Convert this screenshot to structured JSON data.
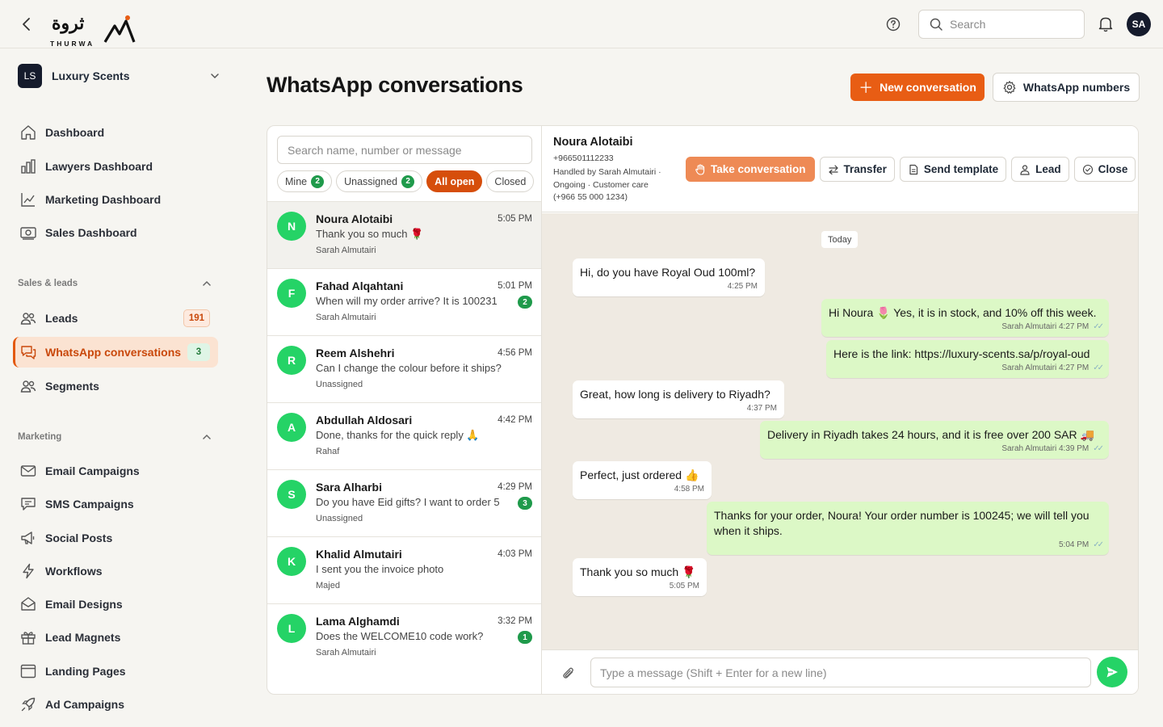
{
  "brand": {
    "arabic": "ثروة",
    "latin": "THURWA"
  },
  "topbar": {
    "search_placeholder": "Search",
    "avatar": "SA"
  },
  "workspace": {
    "initials": "LS",
    "name": "Luxury Scents"
  },
  "nav_primary": [
    {
      "label": "Dashboard",
      "icon": "home-icon"
    },
    {
      "label": "Lawyers Dashboard",
      "icon": "bar-chart-icon"
    },
    {
      "label": "Marketing Dashboard",
      "icon": "line-chart-icon"
    },
    {
      "label": "Sales Dashboard",
      "icon": "money-icon"
    }
  ],
  "sections": {
    "sales": {
      "title": "Sales & leads",
      "items": [
        {
          "label": "Leads",
          "icon": "users-icon",
          "count": "191"
        },
        {
          "label": "WhatsApp conversations",
          "icon": "chat-icon",
          "count": "3"
        },
        {
          "label": "Segments",
          "icon": "users-icon"
        }
      ]
    },
    "marketing": {
      "title": "Marketing",
      "items": [
        {
          "label": "Email Campaigns",
          "icon": "mail-icon"
        },
        {
          "label": "SMS Campaigns",
          "icon": "message-icon"
        },
        {
          "label": "Social Posts",
          "icon": "megaphone-icon"
        },
        {
          "label": "Workflows",
          "icon": "lightning-icon"
        },
        {
          "label": "Email Designs",
          "icon": "envelope-open-icon"
        },
        {
          "label": "Lead Magnets",
          "icon": "gift-icon"
        },
        {
          "label": "Landing Pages",
          "icon": "browser-icon"
        },
        {
          "label": "Ad Campaigns",
          "icon": "rocket-icon"
        }
      ]
    }
  },
  "page": {
    "title": "WhatsApp conversations",
    "new_button": "New conversation",
    "numbers_button": "WhatsApp numbers"
  },
  "conv_list": {
    "search_placeholder": "Search name, number or message",
    "filters": [
      {
        "label": "Mine",
        "count": "2"
      },
      {
        "label": "Unassigned",
        "count": "2"
      },
      {
        "label": "All open",
        "active": true
      },
      {
        "label": "Closed"
      }
    ],
    "items": [
      {
        "initial": "N",
        "name": "Noura Alotaibi",
        "time": "5:05 PM",
        "preview": "Thank you so much 🌹",
        "agent": "Sarah Almutairi",
        "unread": ""
      },
      {
        "initial": "F",
        "name": "Fahad Alqahtani",
        "time": "5:01 PM",
        "preview": "When will my order arrive? It is 100231",
        "agent": "Sarah Almutairi",
        "unread": "2"
      },
      {
        "initial": "R",
        "name": "Reem Alshehri",
        "time": "4:56 PM",
        "preview": "Can I change the colour before it ships?",
        "agent": "Unassigned",
        "unread": ""
      },
      {
        "initial": "A",
        "name": "Abdullah Aldosari",
        "time": "4:42 PM",
        "preview": "Done, thanks for the quick reply 🙏",
        "agent": "Rahaf",
        "unread": ""
      },
      {
        "initial": "S",
        "name": "Sara Alharbi",
        "time": "4:29 PM",
        "preview": "Do you have Eid gifts? I want to order 5",
        "agent": "Unassigned",
        "unread": "3"
      },
      {
        "initial": "K",
        "name": "Khalid Almutairi",
        "time": "4:03 PM",
        "preview": "I sent you the invoice photo",
        "agent": "Majed",
        "unread": ""
      },
      {
        "initial": "L",
        "name": "Lama Alghamdi",
        "time": "3:32 PM",
        "preview": "Does the WELCOME10 code work?",
        "agent": "Sarah Almutairi",
        "unread": "1"
      }
    ]
  },
  "chat": {
    "contact_name": "Noura Alotaibi",
    "phone": "+966501112233",
    "handled": "Handled by Sarah Almutairi ·",
    "status": "Ongoing · Customer care",
    "alt_phone": "(+966 55 000 1234)",
    "actions": {
      "take": "Take conversation",
      "transfer": "Transfer",
      "template": "Send template",
      "lead": "Lead",
      "close": "Close"
    },
    "day_label": "Today",
    "messages": [
      {
        "dir": "in",
        "text": "Hi, do you have Royal Oud 100ml?",
        "time": "4:25 PM",
        "sender": ""
      },
      {
        "dir": "out",
        "text": "Hi Noura 🌷 Yes, it is in stock, and 10% off this week.",
        "time": "4:27 PM",
        "sender": "Sarah Almutairi"
      },
      {
        "dir": "out",
        "text": "Here is the link: https://luxury-scents.sa/p/royal-oud",
        "time": "4:27 PM",
        "sender": "Sarah Almutairi"
      },
      {
        "dir": "in",
        "text": "Great, how long is delivery to Riyadh?",
        "time": "4:37 PM",
        "sender": ""
      },
      {
        "dir": "out",
        "text": "Delivery in Riyadh takes 24 hours, and it is free over 200 SAR 🚚",
        "time": "4:39 PM",
        "sender": "Sarah Almutairi"
      },
      {
        "dir": "in",
        "text": "Perfect, just ordered 👍",
        "time": "4:58 PM",
        "sender": ""
      },
      {
        "dir": "out",
        "text": "Thanks for your order, Noura! Your order number is 100245; we will tell you when it ships.",
        "time": "5:04 PM",
        "sender": ""
      },
      {
        "dir": "in",
        "text": "Thank you so much 🌹",
        "time": "5:05 PM",
        "sender": ""
      }
    ],
    "composer_placeholder": "Type a message (Shift + Enter for a new line)"
  }
}
